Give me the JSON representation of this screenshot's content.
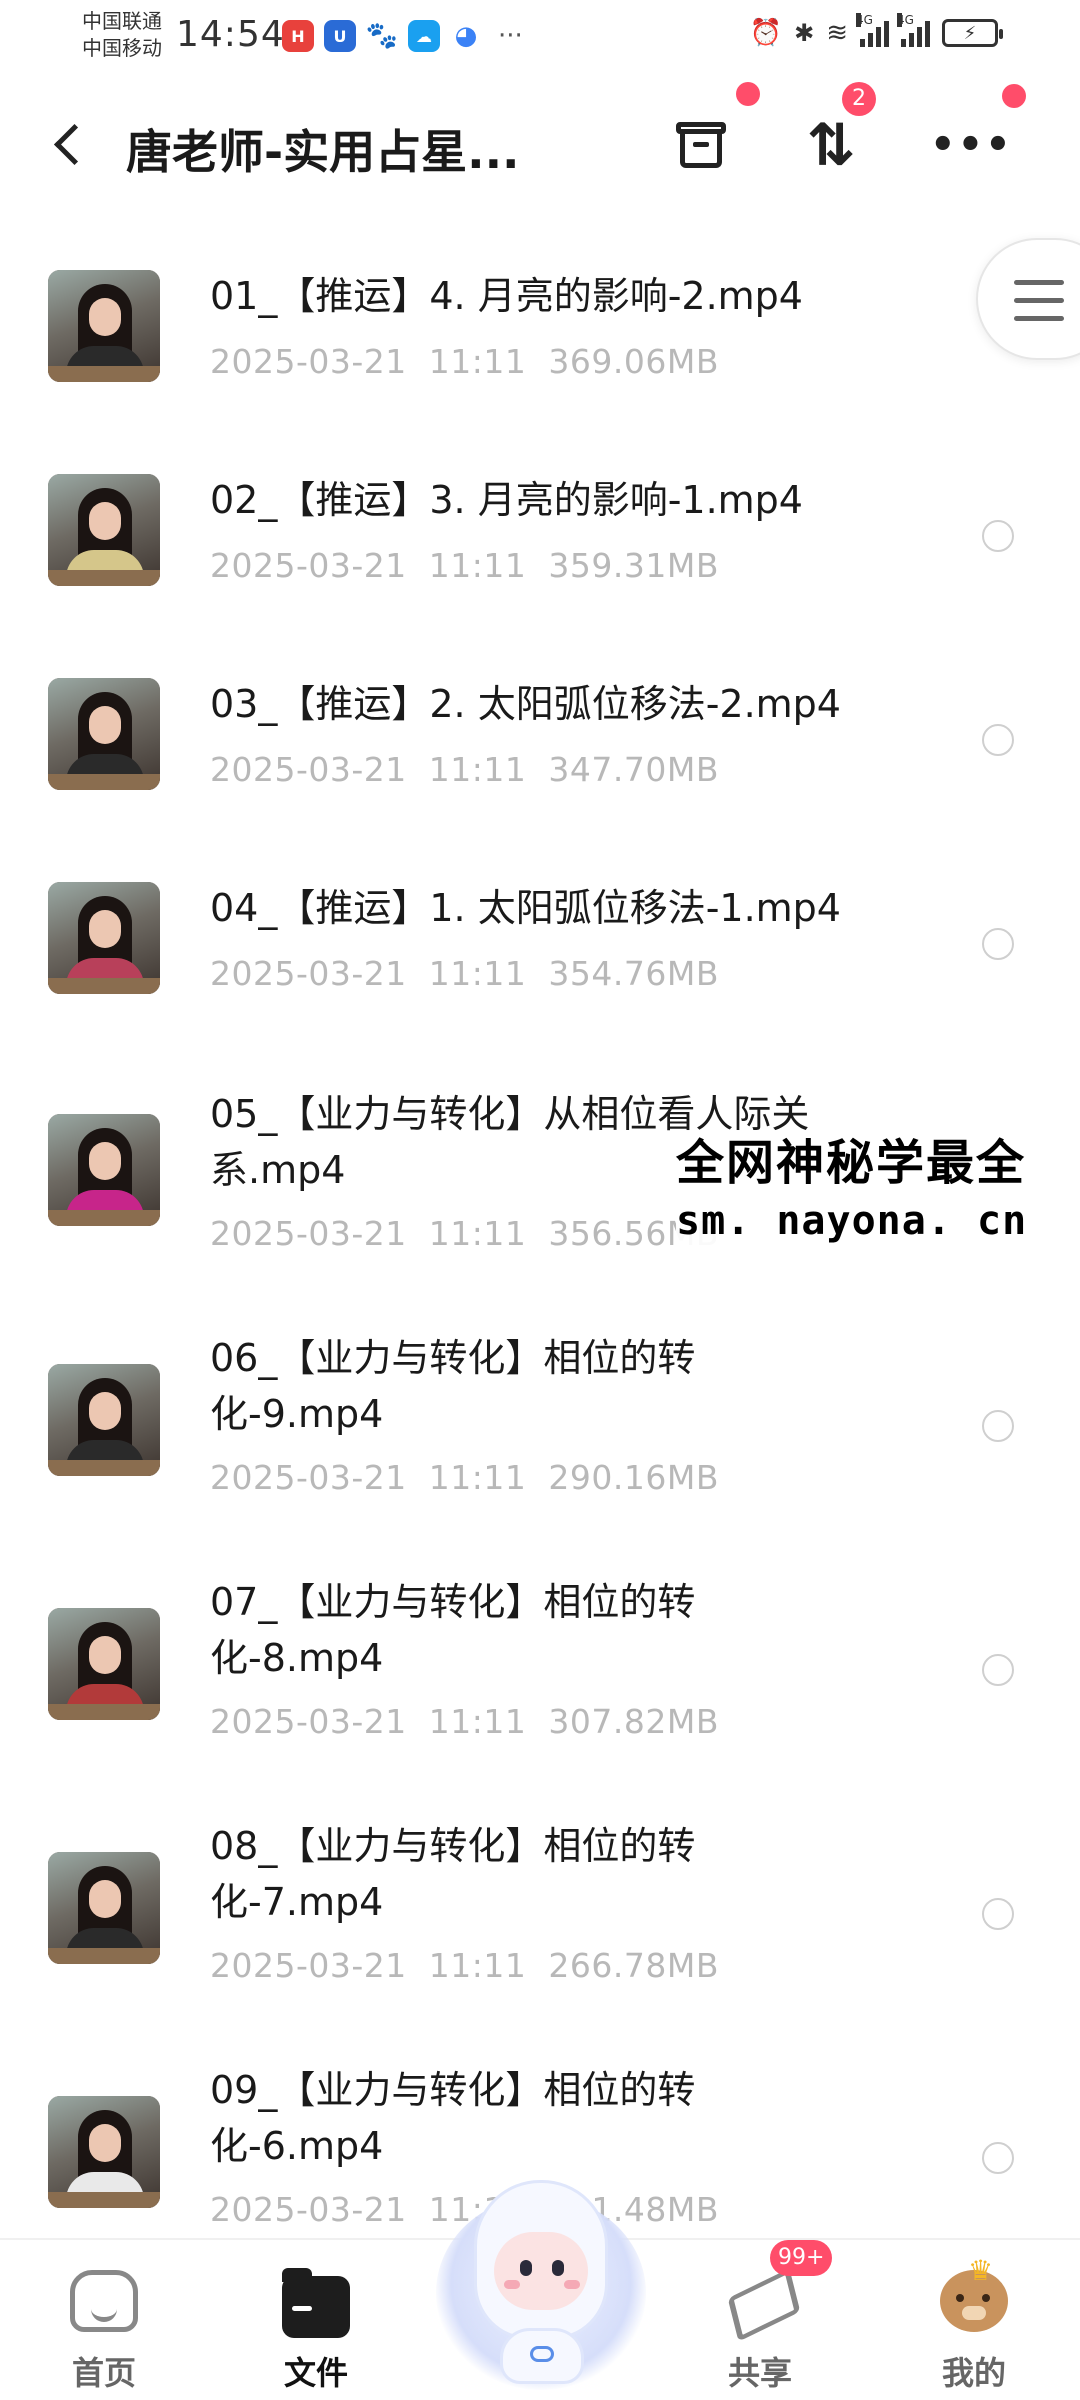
{
  "status_bar": {
    "carrier_1": "中国联通",
    "carrier_2": "中国移动",
    "time": "14:54",
    "app_icons": [
      "huawei-icon",
      "cube-icon",
      "baidu-icon",
      "weather-icon",
      "browser-icon"
    ],
    "more": "···",
    "network_tag_1": "4G",
    "network_tag_2": "4G"
  },
  "header": {
    "title": "唐老师-实用占星...",
    "sort_badge": "2"
  },
  "files": [
    {
      "name": "01_【推运】4. 月亮的影响-2.mp4",
      "date": "2025-03-21",
      "time": "11:11",
      "size": "369.06MB"
    },
    {
      "name": "02_【推运】3. 月亮的影响-1.mp4",
      "date": "2025-03-21",
      "time": "11:11",
      "size": "359.31MB"
    },
    {
      "name": "03_【推运】2. 太阳弧位移法-2.mp4",
      "date": "2025-03-21",
      "time": "11:11",
      "size": "347.70MB"
    },
    {
      "name": "04_【推运】1. 太阳弧位移法-1.mp4",
      "date": "2025-03-21",
      "time": "11:11",
      "size": "354.76MB"
    },
    {
      "name": "05_【业力与转化】从相位看人际关系.mp4",
      "date": "2025-03-21",
      "time": "11:11",
      "size": "356.56MB"
    },
    {
      "name": "06_【业力与转化】相位的转化-9.mp4",
      "date": "2025-03-21",
      "time": "11:11",
      "size": "290.16MB"
    },
    {
      "name": "07_【业力与转化】相位的转化-8.mp4",
      "date": "2025-03-21",
      "time": "11:11",
      "size": "307.82MB"
    },
    {
      "name": "08_【业力与转化】相位的转化-7.mp4",
      "date": "2025-03-21",
      "time": "11:11",
      "size": "266.78MB"
    },
    {
      "name": "09_【业力与转化】相位的转化-6.mp4",
      "date": "2025-03-21",
      "time": "11:11",
      "size": "301.48MB"
    }
  ],
  "watermark": {
    "line1": "全网神秘学最全",
    "line2": "sm. nayona. cn"
  },
  "bottom_nav": {
    "home": "首页",
    "files": "文件",
    "share": "共享",
    "share_badge": "99+",
    "me": "我的"
  },
  "colors": {
    "badge": "#ff4d6a",
    "meta_text": "#b8b8b8",
    "title_text": "#1a1a1a"
  }
}
